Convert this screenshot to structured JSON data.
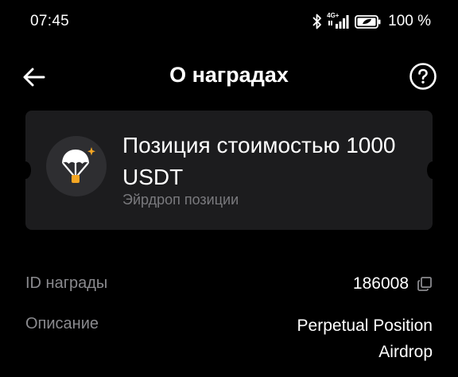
{
  "status_bar": {
    "time": "07:45",
    "network_label": "4G+",
    "battery_percent": "100 %",
    "icons": [
      "bluetooth-icon",
      "signal-icon",
      "battery-icon"
    ]
  },
  "header": {
    "title": "О наградах",
    "back_icon": "arrow-left-icon",
    "help_icon": "question-circle-icon"
  },
  "reward": {
    "icon": "parachute-icon",
    "title": "Позиция стоимостью 1000 USDT",
    "subtitle": "Эйрдроп позиции"
  },
  "details": {
    "id_label": "ID награды",
    "id_value": "186008",
    "copy_icon": "copy-icon",
    "description_label": "Описание",
    "description_value": "Perpetual Position Airdrop"
  },
  "colors": {
    "background": "#000000",
    "card": "#1c1c1e",
    "muted_text": "#8a8a8e",
    "accent": "#f5a623"
  }
}
